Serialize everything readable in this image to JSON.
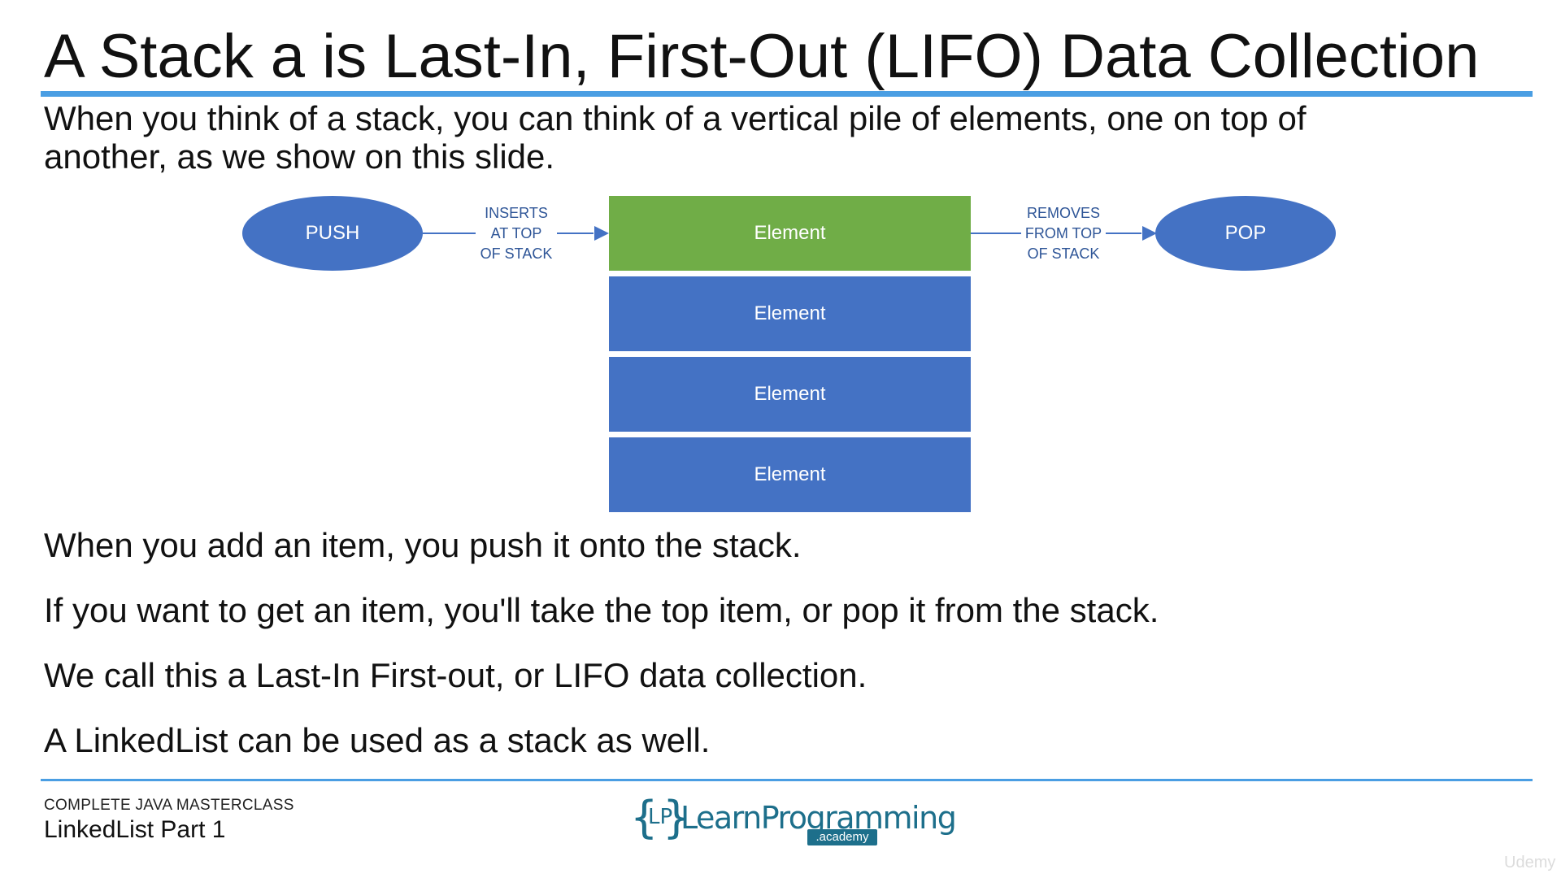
{
  "slide": {
    "title": "A Stack a is Last-In, First-Out (LIFO) Data Collection",
    "intro_line1": "When you think of a stack, you can think of a vertical pile of elements, one on top of",
    "intro_line2": "another, as we show on this slide.",
    "colors": {
      "accent_rule": "#4a9ee3",
      "shape_blue": "#4472c4",
      "top_green": "#70ad47",
      "arrow_text": "#2e5597"
    }
  },
  "diagram": {
    "push_label": "PUSH",
    "pop_label": "POP",
    "insert_label": [
      "INSERTS",
      "AT TOP",
      "OF STACK"
    ],
    "remove_label": [
      "REMOVES",
      "FROM TOP",
      "OF STACK"
    ],
    "elements": [
      "Element",
      "Element",
      "Element",
      "Element"
    ]
  },
  "bullets": [
    "When you add an item, you push it onto the stack.",
    "If you want to get an item, you'll take the top item, or pop it from the stack.",
    "We call this a Last-In First-out, or LIFO data collection.",
    "A LinkedList can be used as a stack as well."
  ],
  "footer": {
    "course": "COMPLETE JAVA MASTERCLASS",
    "lecture": "LinkedList Part 1",
    "logo_open_brace": "{",
    "logo_initials": "LP",
    "logo_close_brace": "}",
    "logo_name": "LearnProgramming",
    "logo_sub": ".academy",
    "watermark": "Udemy"
  }
}
